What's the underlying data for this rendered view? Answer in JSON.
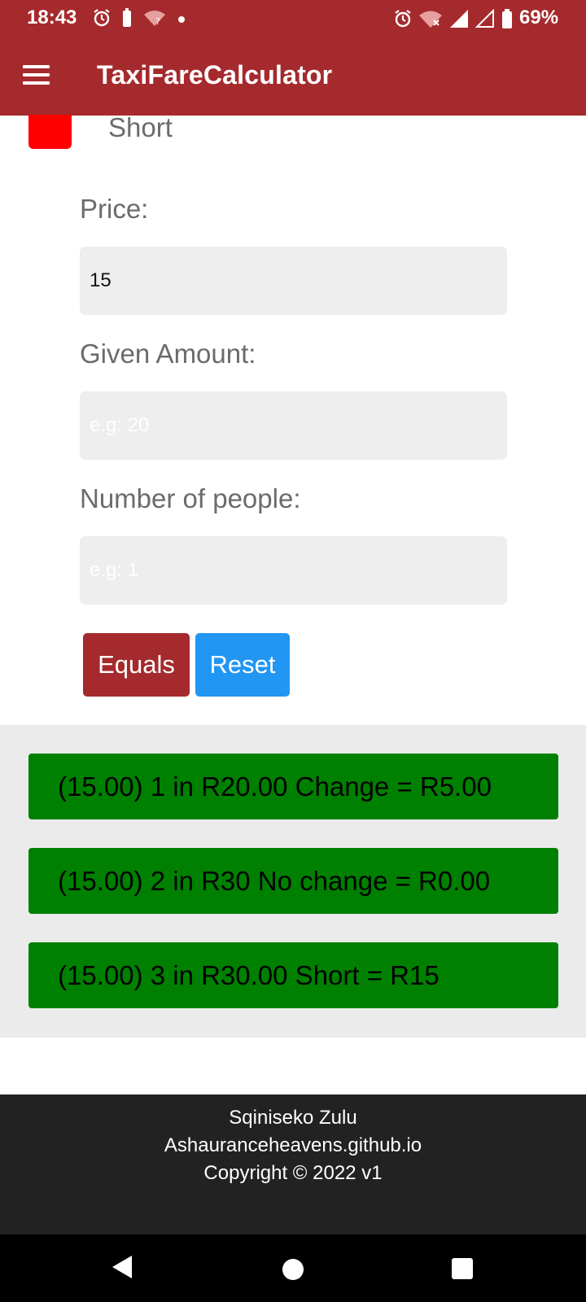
{
  "status_bar": {
    "time": "18:43",
    "battery": "69%",
    "icons_left": [
      "alarm-icon",
      "battery-saver-icon",
      "wifi-question-icon",
      "dot-icon"
    ],
    "icons_right": [
      "alarm-icon",
      "wifi-off-icon",
      "signal-icon",
      "signal-empty-icon",
      "battery-icon"
    ]
  },
  "app_bar": {
    "title": "TaxiFareCalculator",
    "menu_icon": "hamburger-menu-icon"
  },
  "legend": {
    "label": "Short",
    "color": "#ff0000"
  },
  "form": {
    "price_label": "Price:",
    "price_value": "15",
    "given_label": "Given Amount:",
    "given_placeholder": "e.g: 20",
    "people_label": "Number of people:",
    "people_placeholder": "e.g: 1"
  },
  "buttons": {
    "equals": "Equals",
    "reset": "Reset"
  },
  "results": [
    {
      "text": "(15.00) 1 in R20.00 Change = R5.00",
      "color": "#008000"
    },
    {
      "text": "(15.00) 2 in R30 No change = R0.00",
      "color": "#008000"
    },
    {
      "text": "(15.00) 3 in R30.00 Short = R15",
      "color": "#008000"
    }
  ],
  "footer": {
    "name": "Sqiniseko Zulu",
    "site": "Ashauranceheavens.github.io",
    "copyright": "Copyright © 2022 v1"
  },
  "colors": {
    "primary": "#a52a2d",
    "reset": "#2196f3",
    "result_bg": "#008000",
    "footer_bg": "#222222"
  }
}
